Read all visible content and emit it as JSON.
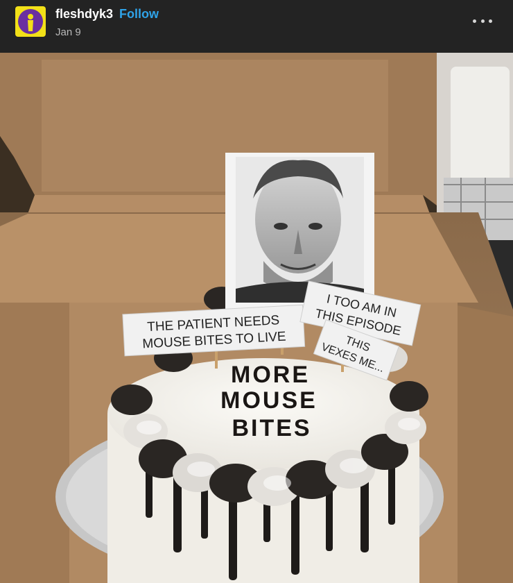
{
  "post": {
    "author": "fleshdyk3",
    "follow_label": "Follow",
    "date": "Jan 9",
    "more_icon": "more-options-icon",
    "avatar_icon": "avatar-icon"
  },
  "photo": {
    "signs": {
      "left_line1": "THE PATIENT NEEDS",
      "left_line2": "MOUSE BITES TO LIVE",
      "right_line1": "I TOO AM IN",
      "right_line2": "THIS EPISODE",
      "small_line1": "THIS",
      "small_line2": "VEXES ME..."
    },
    "cake_text": {
      "line1": "MORE",
      "line2": "MOUSE",
      "line3": "BITES"
    }
  }
}
